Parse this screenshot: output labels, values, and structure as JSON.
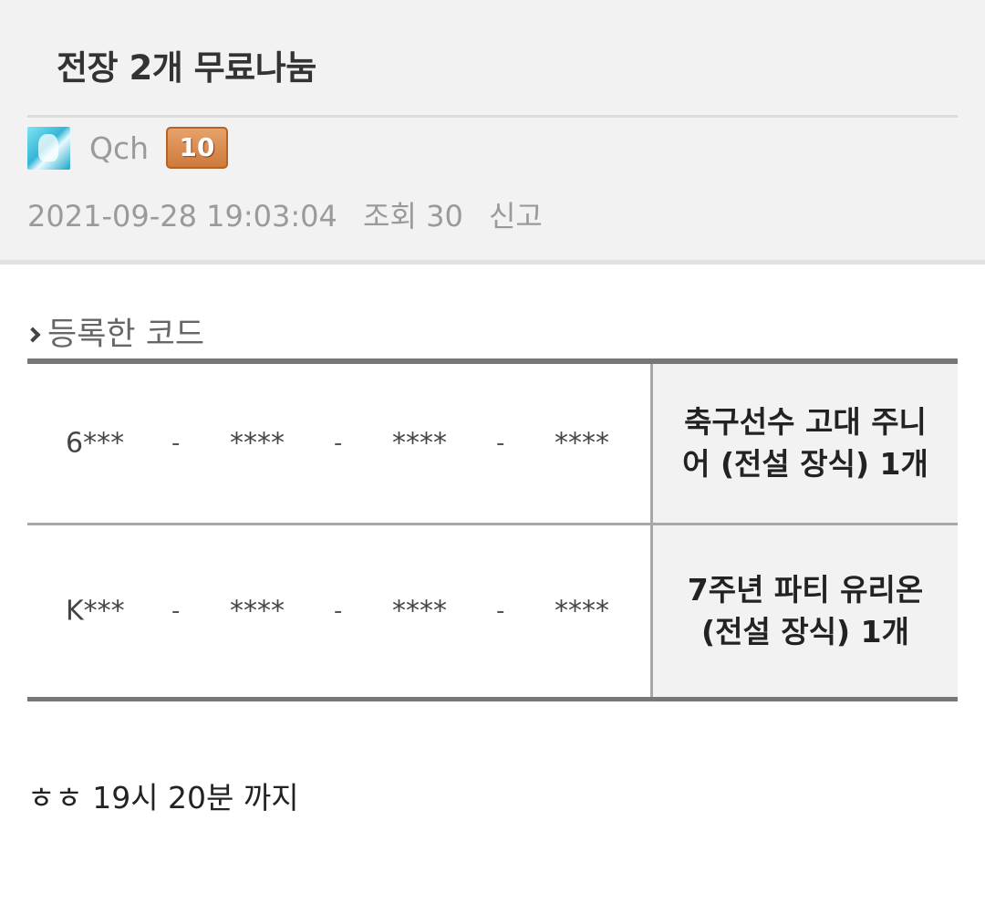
{
  "post": {
    "title": "전장 2개 무료나눔",
    "author": {
      "name": "Qch",
      "level": "10",
      "avatar_icon": "character-avatar-icon"
    },
    "meta": {
      "datetime": "2021-09-28 19:03:04",
      "views": "조회 30",
      "report_label": "신고"
    }
  },
  "codes_section": {
    "title": "등록한 코드",
    "rows": [
      {
        "code_parts": [
          "6***",
          "****",
          "****",
          "****"
        ],
        "separator": "-",
        "reward": "축구선수 고대 주니어 (전설 장식) 1개"
      },
      {
        "code_parts": [
          "K***",
          "****",
          "****",
          "****"
        ],
        "separator": "-",
        "reward": "7주년 파티 유리온 (전설 장식) 1개"
      }
    ]
  },
  "note": "ㅎㅎ 19시 20분 까지",
  "colors": {
    "header_bg": "#f2f2f2",
    "muted_text": "#9a9a9a",
    "table_border": "#777777",
    "badge_orange": "#cd7a3c"
  }
}
